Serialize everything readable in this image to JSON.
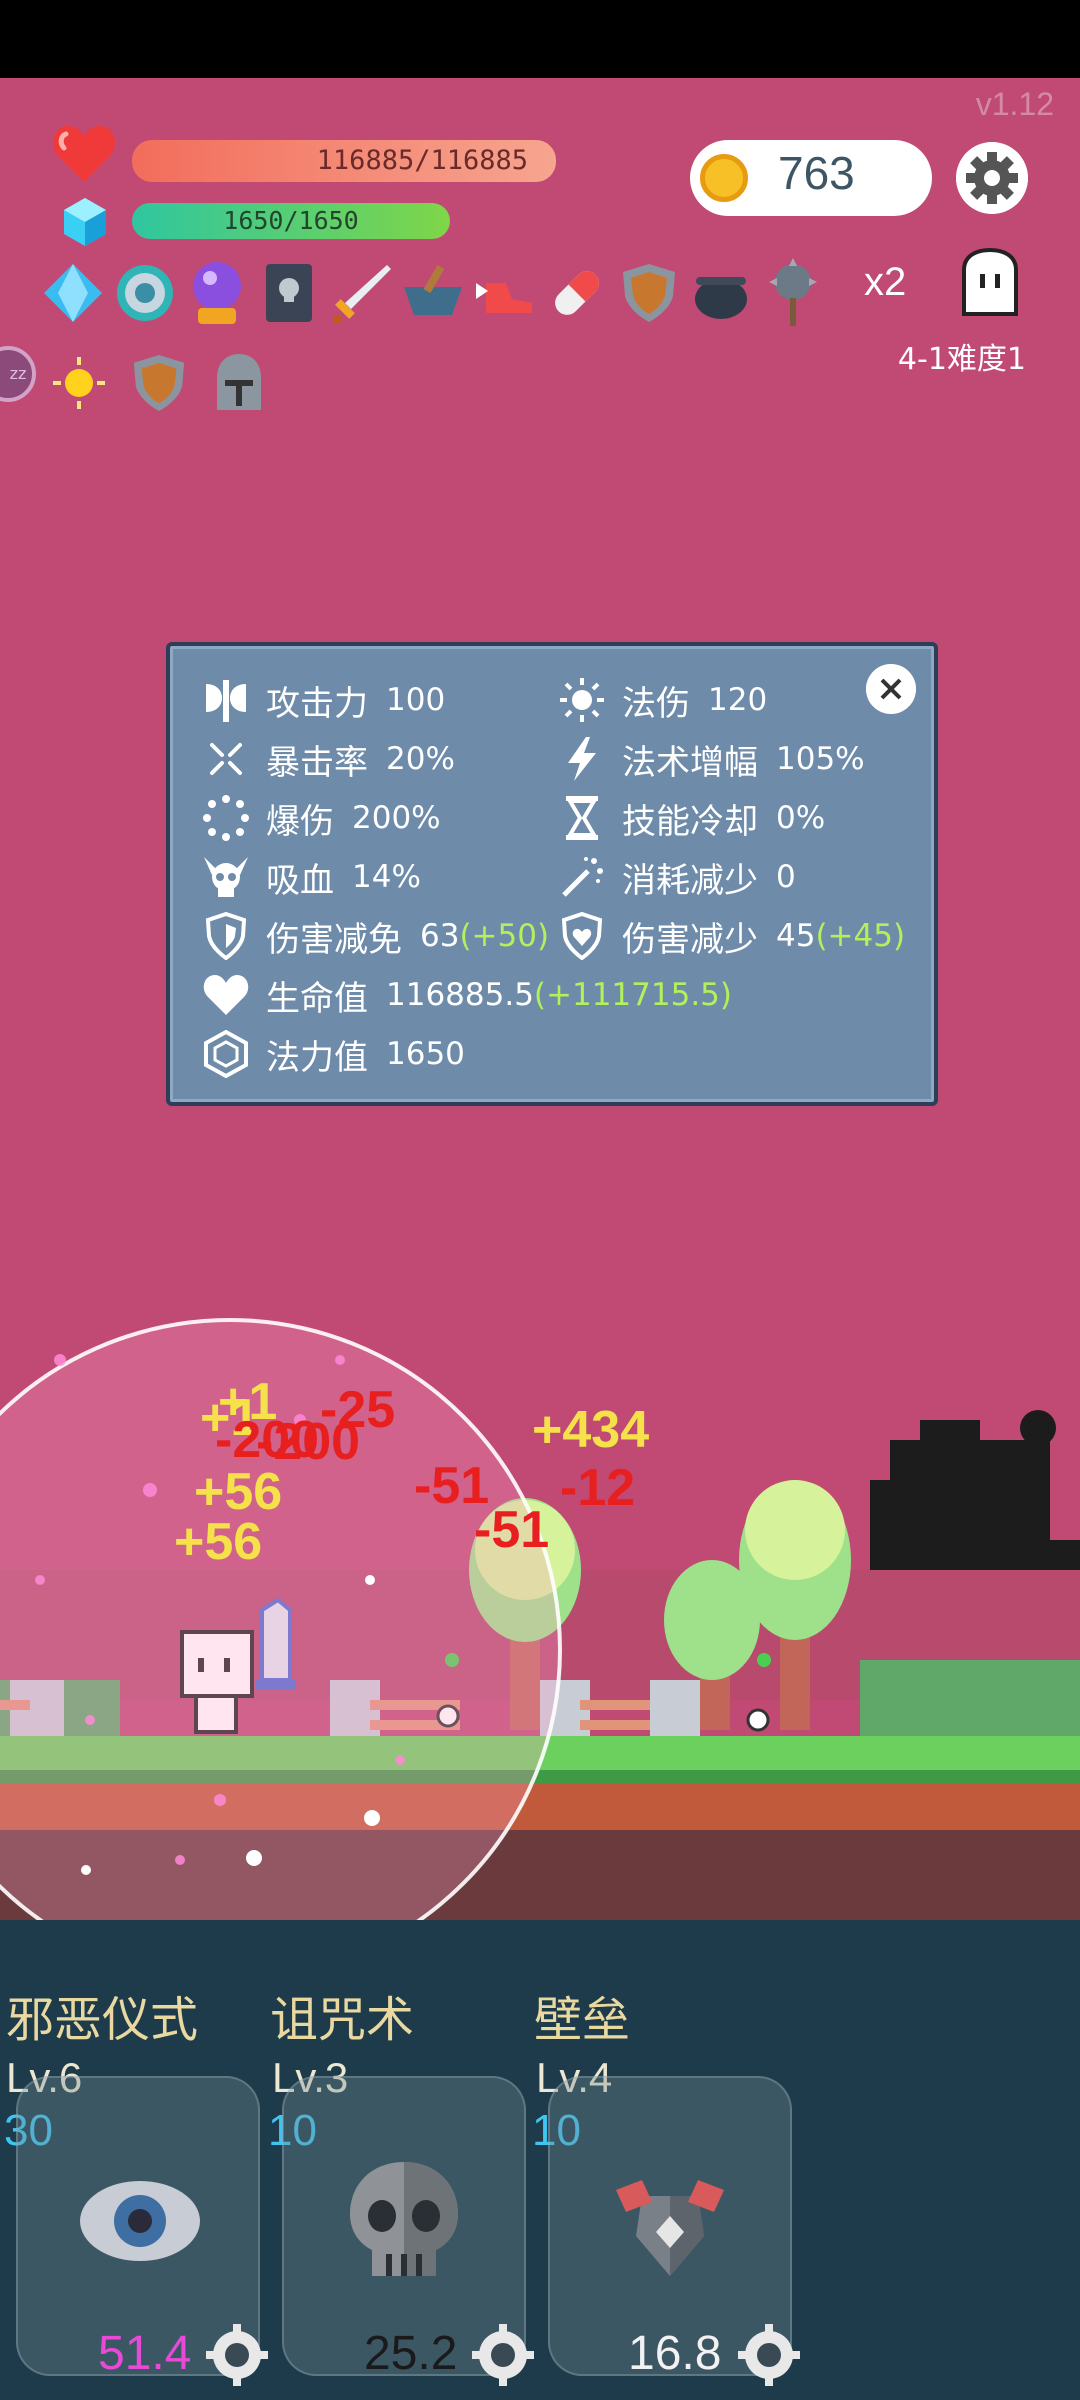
{
  "version": "v1.12",
  "player": {
    "hp_text": "116885/116885",
    "hp_fill": 1.0,
    "mp_text": "1650/1650",
    "mp_fill": 1.0
  },
  "currency": {
    "coins": "763",
    "icon": "coin-icon"
  },
  "controls": {
    "speed": "x2",
    "stage": "4-1难度1",
    "sleep_badge": "zz"
  },
  "items": [
    "diamond-icon",
    "orb-ring-icon",
    "crystal-ball-icon",
    "skull-book-icon",
    "sword-icon",
    "mortar-icon",
    "winged-shoe-icon",
    "pill-icon",
    "shield-icon",
    "cauldron-icon",
    "spiked-mace-icon"
  ],
  "items2": [
    "sun-orb-icon",
    "shield-icon",
    "helmet-icon"
  ],
  "stats": [
    {
      "icon": "axe-icon",
      "name": "攻击力",
      "value": "100",
      "bonus": ""
    },
    {
      "icon": "sun-icon",
      "name": "法伤",
      "value": "120",
      "bonus": ""
    },
    {
      "icon": "crit-icon",
      "name": "暴击率",
      "value": "20%",
      "bonus": ""
    },
    {
      "icon": "lightning-icon",
      "name": "法术增幅",
      "value": "105%",
      "bonus": ""
    },
    {
      "icon": "burst-icon",
      "name": "爆伤",
      "value": "200%",
      "bonus": ""
    },
    {
      "icon": "hourglass-icon",
      "name": "技能冷却",
      "value": "0%",
      "bonus": ""
    },
    {
      "icon": "horned-skull-icon",
      "name": "吸血",
      "value": "14%",
      "bonus": ""
    },
    {
      "icon": "wand-icon",
      "name": "消耗减少",
      "value": "0",
      "bonus": ""
    },
    {
      "icon": "shield-icon",
      "name": "伤害减免",
      "value": "63",
      "bonus": "(+50)"
    },
    {
      "icon": "shield-heart-icon",
      "name": "伤害减少",
      "value": "45",
      "bonus": "(+45)"
    },
    {
      "icon": "heart-icon",
      "name": "生命值",
      "value": "116885.5",
      "bonus": "(+111715.5)"
    },
    {
      "icon": "hexagon-icon",
      "name": "法力值",
      "value": "1650",
      "bonus": ""
    }
  ],
  "damage_numbers": [
    {
      "text": "+1",
      "color": "yellow"
    },
    {
      "text": "+1",
      "color": "yellow"
    },
    {
      "text": "-200",
      "color": "red"
    },
    {
      "text": "-200",
      "color": "red"
    },
    {
      "text": "-25",
      "color": "red"
    },
    {
      "text": "+56",
      "color": "yellow"
    },
    {
      "text": "+56",
      "color": "yellow"
    },
    {
      "text": "+434",
      "color": "yellow"
    },
    {
      "text": "-51",
      "color": "red"
    },
    {
      "text": "-12",
      "color": "red"
    },
    {
      "text": "-51",
      "color": "red"
    }
  ],
  "skills": [
    {
      "name": "邪恶仪式",
      "level": "Lv.6",
      "cost": "30",
      "cooldown": "51.4",
      "cd_color": "#e84ad8",
      "icon": "eye-icon"
    },
    {
      "name": "诅咒术",
      "level": "Lv.3",
      "cost": "10",
      "cooldown": "25.2",
      "cd_color": "#1a1a1a",
      "icon": "skull-icon"
    },
    {
      "name": "壁垒",
      "level": "Lv.4",
      "cost": "10",
      "cooldown": "16.8",
      "cd_color": "#f2f2f2",
      "icon": "armor-icon"
    }
  ],
  "colors": {
    "background": "#c04a74",
    "panel": "#6e8ba9",
    "bonus": "#b2f05c",
    "mp_cost": "#3ec5f2"
  }
}
